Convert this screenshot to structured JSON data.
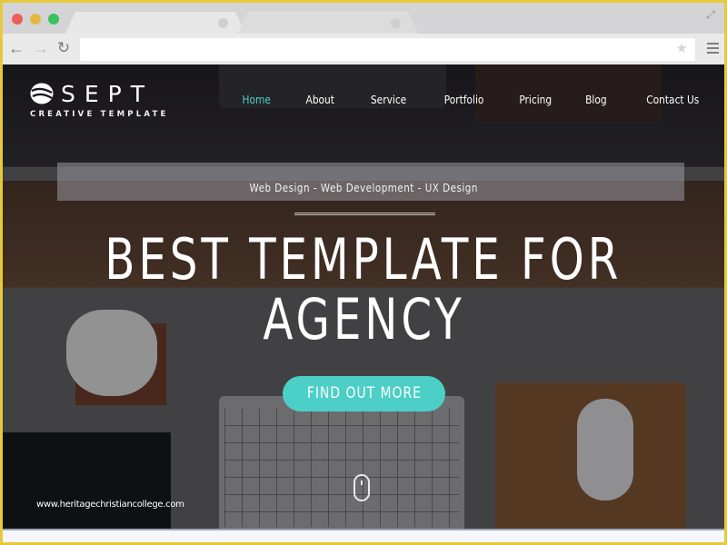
{
  "browser": {
    "window_controls": [
      "close",
      "minimize",
      "maximize"
    ],
    "tabs": [
      {
        "label": "",
        "state": "active"
      },
      {
        "label": "",
        "state": "inactive"
      }
    ],
    "toolbar": {
      "back_icon": "←",
      "forward_icon": "→",
      "reload_icon": "↻",
      "address_value": "",
      "bookmark_icon": "★",
      "fullscreen_icon": "⤢"
    }
  },
  "site": {
    "logo": {
      "name": "SEPT",
      "tagline": "CREATIVE TEMPLATE"
    },
    "nav": {
      "items": [
        {
          "label": "Home",
          "active": true
        },
        {
          "label": "About",
          "active": false
        },
        {
          "label": "Service",
          "active": false
        },
        {
          "label": "Portfolio",
          "active": false
        },
        {
          "label": "Pricing",
          "active": false
        },
        {
          "label": "Blog",
          "active": false
        },
        {
          "label": "Contact Us",
          "active": false
        }
      ]
    },
    "hero": {
      "subtitle": "Web Design - Web Development - UX Design",
      "headline_line1": "BEST TEMPLATE FOR",
      "headline_line2": "AGENCY",
      "cta_label": "FIND OUT MORE"
    },
    "watermark": "www.heritagechristiancollege.com"
  },
  "colors": {
    "accent": "#4ccfc6",
    "nav_active": "#4fcfc4",
    "frame_border": "#e6c93a"
  }
}
